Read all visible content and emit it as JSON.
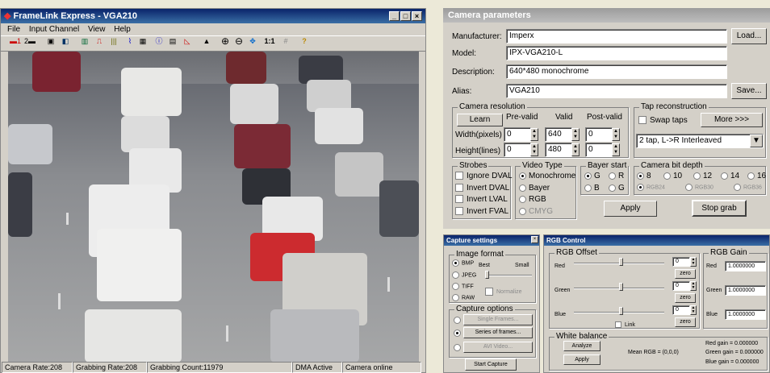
{
  "framelink": {
    "title": "FrameLink Express - VGA210",
    "menu": [
      "File",
      "Input Channel",
      "View",
      "Help"
    ],
    "toolbar": [
      {
        "icon": "single-grab-icon",
        "glyph": "▬1"
      },
      {
        "icon": "continuous-grab-icon",
        "glyph": "2▬"
      },
      {
        "icon": "camera-icon",
        "glyph": "▣"
      },
      {
        "icon": "camera-settings-icon",
        "glyph": "◧"
      },
      {
        "icon": "book-icon",
        "glyph": "▥"
      },
      {
        "icon": "signal-icon",
        "glyph": "⎍"
      },
      {
        "icon": "bars-icon",
        "glyph": "|||"
      },
      {
        "icon": "trigger-icon",
        "glyph": "⌇"
      },
      {
        "icon": "window-icon",
        "glyph": "▦"
      },
      {
        "icon": "info-icon",
        "glyph": "ⓘ"
      },
      {
        "icon": "grid-icon",
        "glyph": "▤"
      },
      {
        "icon": "histogram-icon",
        "glyph": "◺"
      },
      {
        "icon": "image-icon",
        "glyph": "▲"
      },
      {
        "icon": "zoom-in-icon",
        "glyph": "⊕"
      },
      {
        "icon": "zoom-out-icon",
        "glyph": "⊖"
      },
      {
        "icon": "fit-icon",
        "glyph": "✥"
      },
      {
        "icon": "actual-size-icon",
        "glyph": "1:1"
      },
      {
        "icon": "crosshair-icon",
        "glyph": "#"
      },
      {
        "icon": "help-icon",
        "glyph": "?"
      }
    ],
    "status": {
      "camera_rate": "Camera Rate:208",
      "grabbing_rate": "Grabbing Rate:208",
      "grabbing_count": "Grabbing Count:11979",
      "dma": "DMA Active",
      "camera_online": "Camera online"
    }
  },
  "camera_params": {
    "title": "Camera parameters",
    "manufacturer_label": "Manufacturer:",
    "manufacturer": "Imperx",
    "model_label": "Model:",
    "model": "IPX-VGA210-L",
    "description_label": "Description:",
    "description": "640*480 monochrome",
    "alias_label": "Alias:",
    "alias": "VGA210",
    "load_button": "Load...",
    "save_button": "Save...",
    "resolution": {
      "legend": "Camera resolution",
      "learn": "Learn",
      "prevalid": "Pre-valid",
      "valid": "Valid",
      "postvalid": "Post-valid",
      "width_label": "Width(pixels)",
      "height_label": "Height(lines)",
      "width_pre": "0",
      "width_valid": "640",
      "width_post": "0",
      "height_pre": "0",
      "height_valid": "480",
      "height_post": "0"
    },
    "tap": {
      "legend": "Tap reconstruction",
      "swap": "Swap taps",
      "more": "More >>>",
      "selected": "2 tap, L->R Interleaved"
    },
    "strobes": {
      "legend": "Strobes",
      "items": [
        "Ignore DVAL",
        "Invert DVAL",
        "Invert LVAL",
        "Invert FVAL"
      ]
    },
    "video_type": {
      "legend": "Video Type",
      "items": [
        "Monochrome",
        "Bayer",
        "RGB",
        "CMYG"
      ]
    },
    "bayer_start": {
      "legend": "Bayer start",
      "items": [
        "G",
        "R",
        "B",
        "G"
      ]
    },
    "bit_depth": {
      "legend": "Camera bit depth",
      "items": [
        "8",
        "10",
        "12",
        "14",
        "16"
      ],
      "rgb_items": [
        "RGB24",
        "RGB30",
        "RGB36"
      ]
    },
    "apply": "Apply",
    "stop_grab": "Stop grab"
  },
  "capture": {
    "title": "Capture settings",
    "image_format": "Image format",
    "formats": [
      "BMP",
      "JPEG",
      "TIFF",
      "RAW"
    ],
    "best": "Best",
    "small": "Small",
    "normalize": "Normalize",
    "options": "Capture options",
    "single": "Single Frames...",
    "series": "Series of frames...",
    "avi": "AVI Video...",
    "start": "Start Capture"
  },
  "rgb": {
    "title": "RGB Control",
    "offset_legend": "RGB Offset",
    "gain_legend": "RGB Gain",
    "red": "Red",
    "green": "Green",
    "blue": "Blue",
    "red_offset": "0",
    "green_offset": "0",
    "blue_offset": "0",
    "zero": "zero",
    "link": "Link",
    "red_gain": "1.0000000",
    "green_gain": "1.0000000",
    "blue_gain": "1.0000000",
    "white_balance": "White balance",
    "analyze": "Analyze",
    "apply": "Apply",
    "mean_rgb": "Mean RGB = (0,0,0)",
    "red_gain_out": "Red gain =   0.000000",
    "green_gain_out": "Green gain =   0.000000",
    "blue_gain_out": "Blue gain =   0.000000"
  }
}
